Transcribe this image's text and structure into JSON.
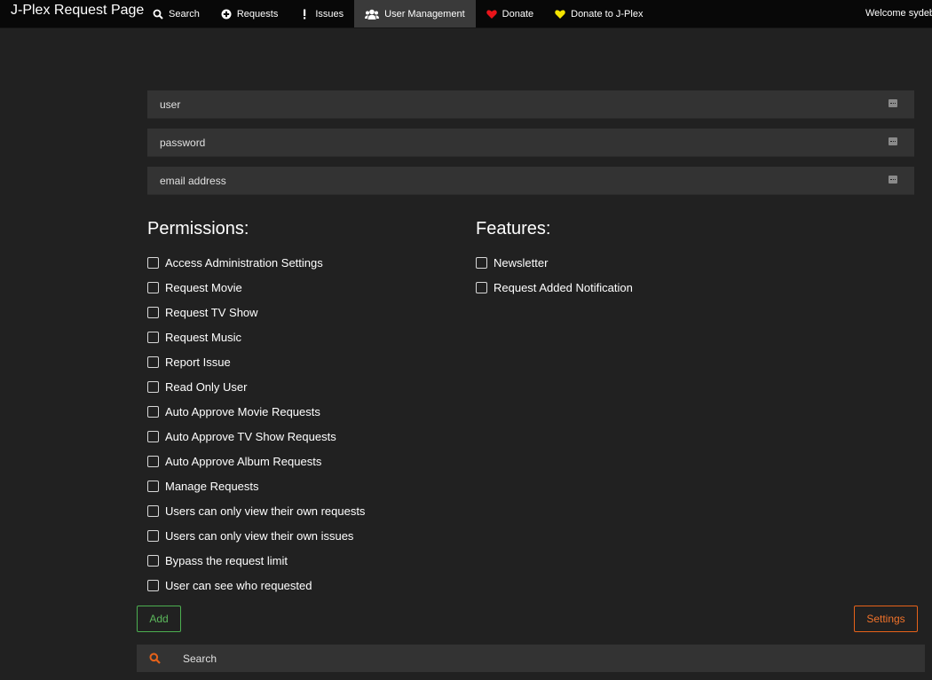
{
  "navbar": {
    "brand": "J-Plex Request Page",
    "items": [
      {
        "label": "Search",
        "icon": "search-icon",
        "active": false
      },
      {
        "label": "Requests",
        "icon": "plus-circle-icon",
        "active": false
      },
      {
        "label": "Issues",
        "icon": "exclamation-icon",
        "active": false
      },
      {
        "label": "User Management",
        "icon": "users-icon",
        "active": true
      },
      {
        "label": "Donate",
        "icon": "heart-icon",
        "active": false
      },
      {
        "label": "Donate to J-Plex",
        "icon": "heart-icon",
        "active": false
      }
    ],
    "welcome": "Welcome sydeburn"
  },
  "colors": {
    "navbar_bg": "#080808",
    "page_bg": "#212121",
    "field_bg": "#333333",
    "donate_heart": "#e8141a",
    "donate_jplex_heart": "#f5e400",
    "add_button": "#5cb85c",
    "settings_button": "#f0722a",
    "search_icon": "#e6621a"
  },
  "form": {
    "user_placeholder": "user",
    "password_placeholder": "password",
    "email_placeholder": "email address"
  },
  "permissions": {
    "title": "Permissions:",
    "items": [
      "Access Administration Settings",
      "Request Movie",
      "Request TV Show",
      "Request Music",
      "Report Issue",
      "Read Only User",
      "Auto Approve Movie Requests",
      "Auto Approve TV Show Requests",
      "Auto Approve Album Requests",
      "Manage Requests",
      "Users can only view their own requests",
      "Users can only view their own issues",
      "Bypass the request limit",
      "User can see who requested"
    ]
  },
  "features": {
    "title": "Features:",
    "items": [
      "Newsletter",
      "Request Added Notification"
    ]
  },
  "buttons": {
    "add": "Add",
    "settings": "Settings"
  },
  "search": {
    "placeholder": "Search"
  }
}
